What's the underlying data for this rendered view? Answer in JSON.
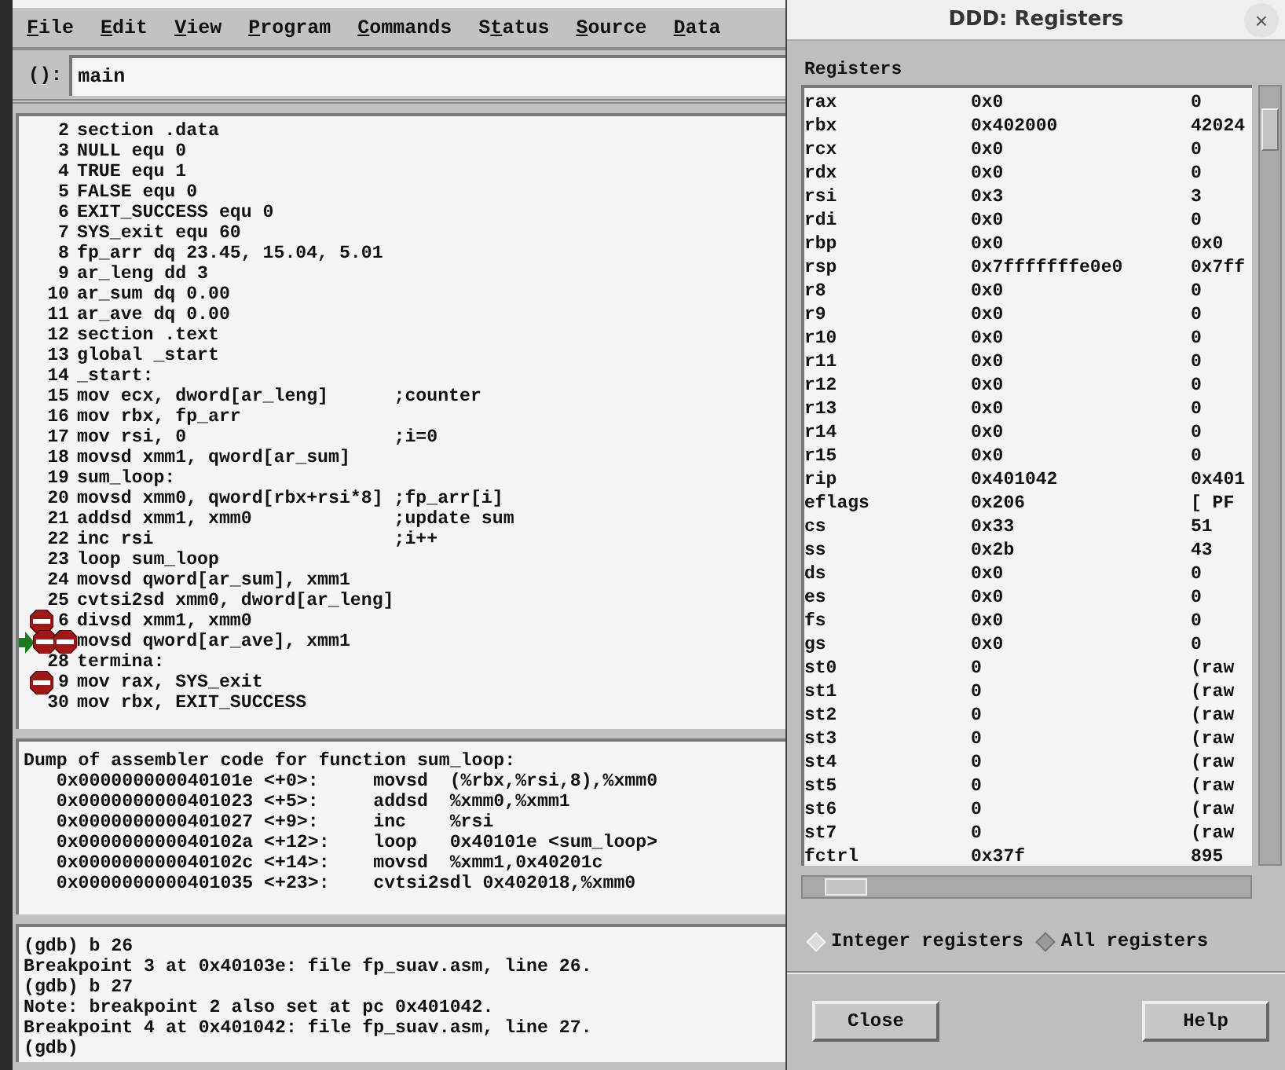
{
  "menu": [
    {
      "key": "F",
      "rest": "ile"
    },
    {
      "key": "E",
      "rest": "dit"
    },
    {
      "key": "V",
      "rest": "iew"
    },
    {
      "key": "P",
      "rest": "rogram"
    },
    {
      "key": "C",
      "rest": "ommands"
    },
    {
      "pre": "S",
      "key": "t",
      "rest": "atus"
    },
    {
      "key": "S",
      "rest": "ource"
    },
    {
      "key": "D",
      "rest": "ata"
    }
  ],
  "argument": {
    "label": "():",
    "value": "main"
  },
  "source": [
    {
      "number": "2",
      "code": "section .data"
    },
    {
      "number": "3",
      "code": "NULL equ 0"
    },
    {
      "number": "4",
      "code": "TRUE equ 1"
    },
    {
      "number": "5",
      "code": "FALSE equ 0"
    },
    {
      "number": "6",
      "code": "EXIT_SUCCESS equ 0"
    },
    {
      "number": "7",
      "code": "SYS_exit equ 60"
    },
    {
      "number": "8",
      "code": "fp_arr dq 23.45, 15.04, 5.01"
    },
    {
      "number": "9",
      "code": "ar_leng dd 3"
    },
    {
      "number": "10",
      "code": "ar_sum dq 0.00"
    },
    {
      "number": "11",
      "code": "ar_ave dq 0.00"
    },
    {
      "number": "12",
      "code": "section .text"
    },
    {
      "number": "13",
      "code": "global _start"
    },
    {
      "number": "14",
      "code": "_start:"
    },
    {
      "number": "15",
      "code": "mov ecx, dword[ar_leng]      ;counter"
    },
    {
      "number": "16",
      "code": "mov rbx, fp_arr"
    },
    {
      "number": "17",
      "code": "mov rsi, 0                   ;i=0"
    },
    {
      "number": "18",
      "code": "movsd xmm1, qword[ar_sum]"
    },
    {
      "number": "19",
      "code": "sum_loop:"
    },
    {
      "number": "20",
      "code": "movsd xmm0, qword[rbx+rsi*8] ;fp_arr[i]"
    },
    {
      "number": "21",
      "code": "addsd xmm1, xmm0             ;update sum"
    },
    {
      "number": "22",
      "code": "inc rsi                      ;i++"
    },
    {
      "number": "23",
      "code": "loop sum_loop"
    },
    {
      "number": "24",
      "code": "movsd qword[ar_sum], xmm1"
    },
    {
      "number": "25",
      "code": "cvtsi2sd xmm0, dword[ar_leng]"
    },
    {
      "number": "6",
      "code": "divsd xmm1, xmm0",
      "markers": [
        {
          "kind": "stop"
        }
      ],
      "current": false
    },
    {
      "code": "movsd qword[ar_ave], xmm1",
      "markers": [
        {
          "kind": "stop"
        },
        {
          "kind": "stop"
        }
      ],
      "current": true
    },
    {
      "number": "28",
      "code": "termina:"
    },
    {
      "number": "9",
      "code": "mov rax, SYS_exit",
      "markers": [
        {
          "kind": "stop"
        }
      ],
      "current": false
    },
    {
      "number": "30",
      "code": "mov rbx, EXIT_SUCCESS"
    }
  ],
  "disassembly": [
    "Dump of assembler code for function sum_loop:",
    "   0x000000000040101e <+0>:     movsd  (%rbx,%rsi,8),%xmm0",
    "   0x0000000000401023 <+5>:     addsd  %xmm0,%xmm1",
    "   0x0000000000401027 <+9>:     inc    %rsi",
    "   0x000000000040102a <+12>:    loop   0x40101e <sum_loop>",
    "   0x000000000040102c <+14>:    movsd  %xmm1,0x40201c",
    "   0x0000000000401035 <+23>:    cvtsi2sdl 0x402018,%xmm0"
  ],
  "console": [
    "(gdb) b 26",
    "Breakpoint 3 at 0x40103e: file fp_suav.asm, line 26.",
    "(gdb) b 27",
    "Note: breakpoint 2 also set at pc 0x401042.",
    "Breakpoint 4 at 0x401042: file fp_suav.asm, line 27.",
    "(gdb) "
  ],
  "dialog": {
    "title": "DDD: Registers",
    "close": "×",
    "label": "Registers",
    "registers": [
      [
        "rax",
        "0x0",
        "0"
      ],
      [
        "rbx",
        "0x402000",
        "42024"
      ],
      [
        "rcx",
        "0x0",
        "0"
      ],
      [
        "rdx",
        "0x0",
        "0"
      ],
      [
        "rsi",
        "0x3",
        "3"
      ],
      [
        "rdi",
        "0x0",
        "0"
      ],
      [
        "rbp",
        "0x0",
        "0x0"
      ],
      [
        "rsp",
        "0x7fffffffe0e0",
        "0x7ff"
      ],
      [
        "r8",
        "0x0",
        "0"
      ],
      [
        "r9",
        "0x0",
        "0"
      ],
      [
        "r10",
        "0x0",
        "0"
      ],
      [
        "r11",
        "0x0",
        "0"
      ],
      [
        "r12",
        "0x0",
        "0"
      ],
      [
        "r13",
        "0x0",
        "0"
      ],
      [
        "r14",
        "0x0",
        "0"
      ],
      [
        "r15",
        "0x0",
        "0"
      ],
      [
        "rip",
        "0x401042",
        "0x401"
      ],
      [
        "eflags",
        "0x206",
        "[ PF"
      ],
      [
        "cs",
        "0x33",
        "51"
      ],
      [
        "ss",
        "0x2b",
        "43"
      ],
      [
        "ds",
        "0x0",
        "0"
      ],
      [
        "es",
        "0x0",
        "0"
      ],
      [
        "fs",
        "0x0",
        "0"
      ],
      [
        "gs",
        "0x0",
        "0"
      ],
      [
        "st0",
        "0",
        "(raw"
      ],
      [
        "st1",
        "0",
        "(raw"
      ],
      [
        "st2",
        "0",
        "(raw"
      ],
      [
        "st3",
        "0",
        "(raw"
      ],
      [
        "st4",
        "0",
        "(raw"
      ],
      [
        "st5",
        "0",
        "(raw"
      ],
      [
        "st6",
        "0",
        "(raw"
      ],
      [
        "st7",
        "0",
        "(raw"
      ],
      [
        "fctrl",
        "0x37f",
        "895"
      ]
    ],
    "modes": [
      {
        "label": "Integer registers",
        "selected": false
      },
      {
        "label": "All registers",
        "selected": true
      }
    ],
    "buttons": [
      "Close",
      "Help"
    ]
  }
}
